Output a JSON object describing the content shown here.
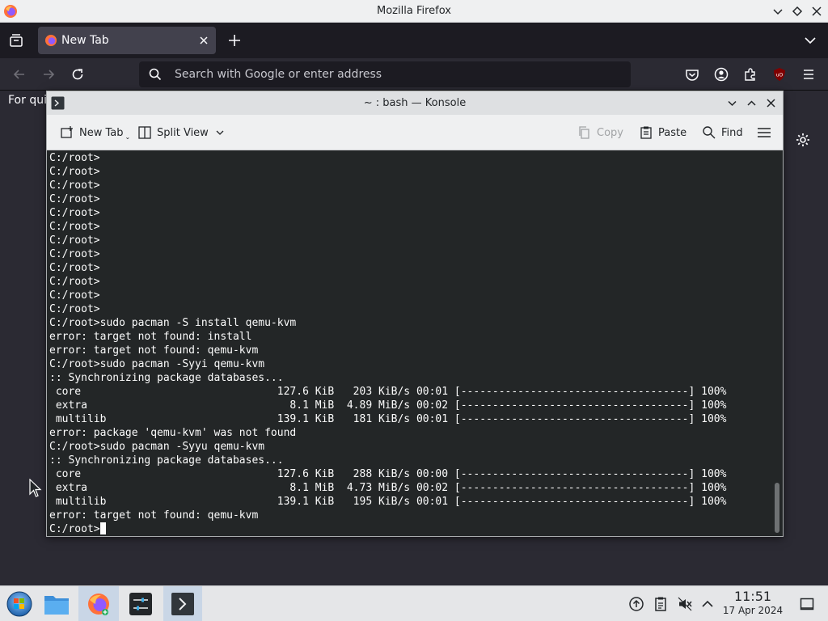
{
  "firefox": {
    "window_title": "Mozilla Firefox",
    "tab_label": "New Tab",
    "search_placeholder": "Search with Google or enter address",
    "bookmark_message": "For qui"
  },
  "konsole": {
    "window_title": "~ : bash — Konsole",
    "toolbar": {
      "new_tab": "New Tab",
      "split_view": "Split View",
      "copy": "Copy",
      "paste": "Paste",
      "find": "Find"
    },
    "lines": [
      "C:/root>",
      "C:/root>",
      "C:/root>",
      "C:/root>",
      "C:/root>",
      "C:/root>",
      "C:/root>",
      "C:/root>",
      "C:/root>",
      "C:/root>",
      "C:/root>",
      "C:/root>",
      "C:/root>sudo pacman -S install qemu-kvm",
      "error: target not found: install",
      "error: target not found: qemu-kvm",
      "C:/root>sudo pacman -Syyi qemu-kvm",
      ":: Synchronizing package databases...",
      " core                               127.6 KiB   203 KiB/s 00:01 [------------------------------------] 100%",
      " extra                                8.1 MiB  4.89 MiB/s 00:02 [------------------------------------] 100%",
      " multilib                           139.1 KiB   181 KiB/s 00:01 [------------------------------------] 100%",
      "error: package 'qemu-kvm' was not found",
      "C:/root>sudo pacman -Syyu qemu-kvm",
      ":: Synchronizing package databases...",
      " core                               127.6 KiB   288 KiB/s 00:00 [------------------------------------] 100%",
      " extra                                8.1 MiB  4.73 MiB/s 00:02 [------------------------------------] 100%",
      " multilib                           139.1 KiB   195 KiB/s 00:01 [------------------------------------] 100%",
      "error: target not found: qemu-kvm"
    ],
    "prompt": "C:/root>"
  },
  "taskbar": {
    "time": "11:51",
    "date": "17 Apr 2024"
  },
  "colors": {
    "terminal_bg": "#232627",
    "terminal_fg": "#fcfcfc",
    "firefox_dark": "#1c1b22",
    "taskbar_bg": "#e5e6e8"
  }
}
